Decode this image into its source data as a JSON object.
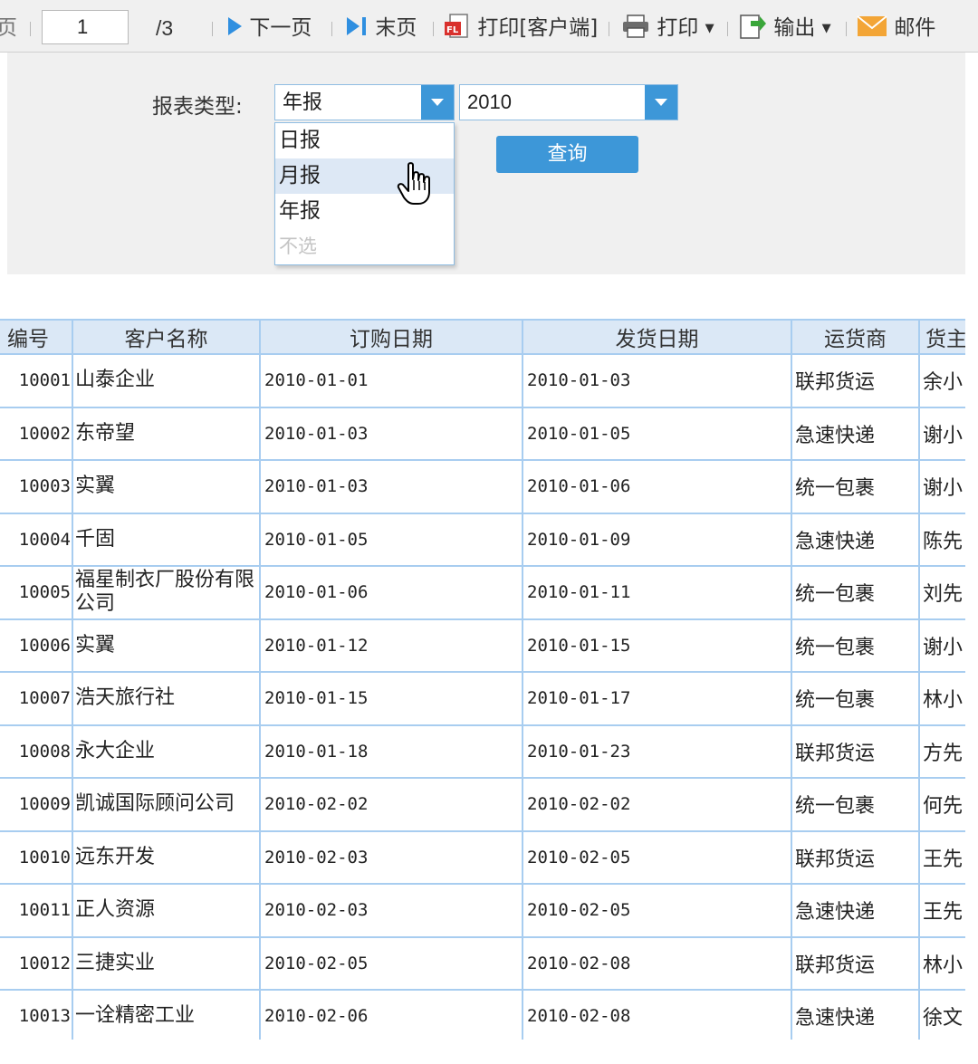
{
  "toolbar": {
    "prev_glyph": "页",
    "current_page": "1",
    "total_pages": "/3",
    "next_label": "下一页",
    "last_label": "末页",
    "print_client_label": "打印[客户端]",
    "print_label": "打印",
    "export_label": "输出",
    "mail_label": "邮件",
    "colors": {
      "accent": "#2f8fe0",
      "pdf_red": "#d9302c",
      "export_green": "#3aa63a",
      "mail_orange": "#f3a536"
    }
  },
  "params": {
    "report_type_label": "报表类型:",
    "report_type_value": "年报",
    "year_value": "2010",
    "query_label": "查询",
    "dropdown_options": [
      "日报",
      "月报",
      "年报",
      "不选"
    ],
    "hovered_option": "月报"
  },
  "table": {
    "headers": [
      "编号",
      "客户名称",
      "订购日期",
      "发货日期",
      "运货商",
      "货主"
    ],
    "rows": [
      [
        "10001",
        "山泰企业",
        "2010-01-01",
        "2010-01-03",
        "联邦货运",
        "余小"
      ],
      [
        "10002",
        "东帝望",
        "2010-01-03",
        "2010-01-05",
        "急速快递",
        "谢小"
      ],
      [
        "10003",
        "实翼",
        "2010-01-03",
        "2010-01-06",
        "统一包裹",
        "谢小"
      ],
      [
        "10004",
        "千固",
        "2010-01-05",
        "2010-01-09",
        "急速快递",
        "陈先"
      ],
      [
        "10005",
        "福星制衣厂股份有限公司",
        "2010-01-06",
        "2010-01-11",
        "统一包裹",
        "刘先"
      ],
      [
        "10006",
        "实翼",
        "2010-01-12",
        "2010-01-15",
        "统一包裹",
        "谢小"
      ],
      [
        "10007",
        "浩天旅行社",
        "2010-01-15",
        "2010-01-17",
        "统一包裹",
        "林小"
      ],
      [
        "10008",
        "永大企业",
        "2010-01-18",
        "2010-01-23",
        "联邦货运",
        "方先"
      ],
      [
        "10009",
        "凯诚国际顾问公司",
        "2010-02-02",
        "2010-02-02",
        "统一包裹",
        "何先"
      ],
      [
        "10010",
        "远东开发",
        "2010-02-03",
        "2010-02-05",
        "联邦货运",
        "王先"
      ],
      [
        "10011",
        "正人资源",
        "2010-02-03",
        "2010-02-05",
        "急速快递",
        "王先"
      ],
      [
        "10012",
        "三捷实业",
        "2010-02-05",
        "2010-02-08",
        "联邦货运",
        "林小"
      ],
      [
        "10013",
        "一诠精密工业",
        "2010-02-06",
        "2010-02-08",
        "急速快递",
        "徐文"
      ]
    ]
  }
}
